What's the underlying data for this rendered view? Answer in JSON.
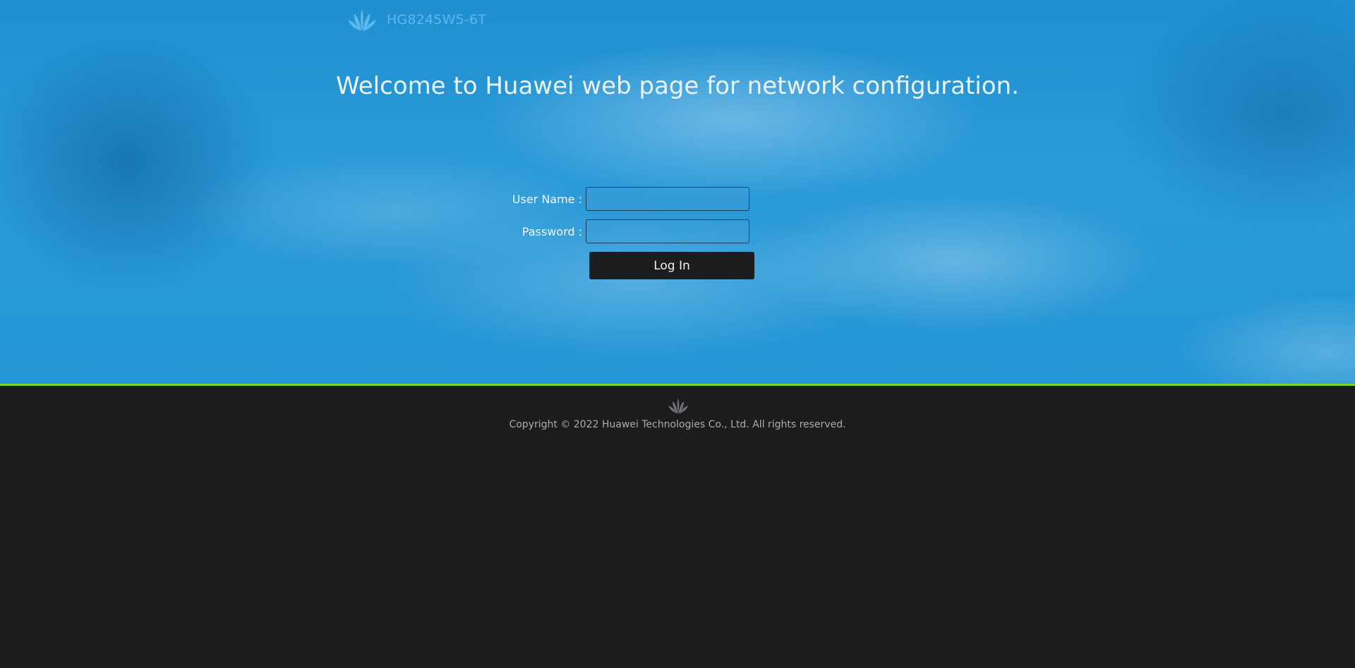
{
  "header": {
    "logo_icon": "huawei-petal-logo-icon",
    "model": "HG8245W5-6T"
  },
  "main": {
    "welcome": "Welcome to Huawei web page for network configuration."
  },
  "login_form": {
    "username_label": "User Name :",
    "username_value": "",
    "password_label": "Password :",
    "password_value": "",
    "login_button": "Log In"
  },
  "footer": {
    "logo_icon": "huawei-petal-logo-icon",
    "copyright": "Copyright © 2022 Huawei Technologies Co., Ltd. All rights reserved."
  },
  "colors": {
    "background_blue": "#2596d5",
    "accent_line": "#7ed321",
    "footer_bg": "#1b1c1e",
    "button_bg": "#1c1d1f"
  }
}
